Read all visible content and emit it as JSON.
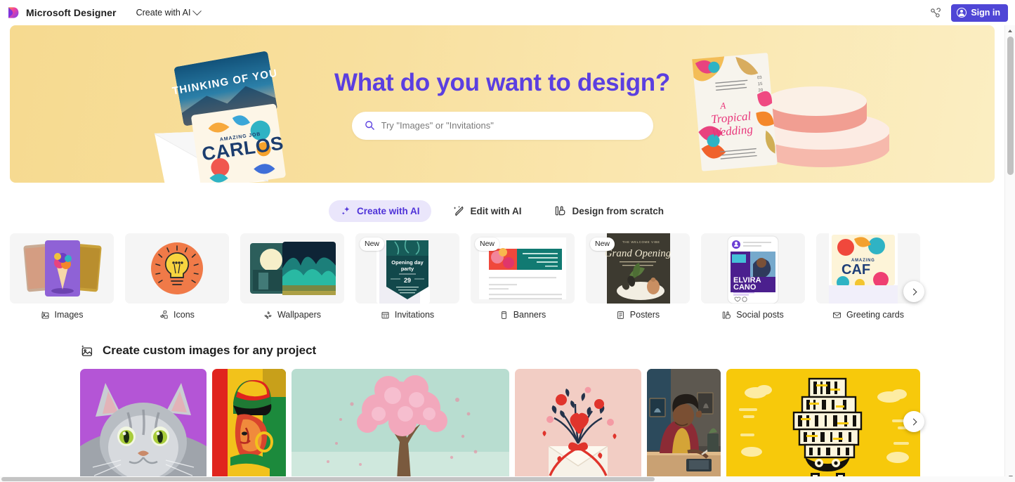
{
  "topbar": {
    "logo_icon": "designer-logo-icon",
    "brand": "Microsoft Designer",
    "nav": {
      "label": "Create with AI",
      "chevron_icon": "chevron-down-icon"
    },
    "share_icon": "link-share-icon",
    "signin": {
      "label": "Sign in",
      "icon": "person-circle-icon",
      "color": "#4f46d6"
    }
  },
  "hero": {
    "title": "What do you want to design?",
    "title_color": "#5b3fe0",
    "background_color": "#f8df9d",
    "search": {
      "placeholder": "Try \"Images\" or \"Invitations\"",
      "value": "",
      "icon": "search-icon"
    },
    "art_left": {
      "card_top_text": "THINKING OF YOU",
      "card_bottom_text": "CARLOS",
      "card_bottom_kicker": "AMAZING JOB"
    },
    "art_right": {
      "card_line1": "A",
      "card_line2": "Tropical",
      "card_line3": "Wedding",
      "card_date": "03 15 20"
    }
  },
  "modes": [
    {
      "label": "Create with AI",
      "icon": "sparkle-icon",
      "active": true
    },
    {
      "label": "Edit with AI",
      "icon": "magic-wand-icon",
      "active": false
    },
    {
      "label": "Design from scratch",
      "icon": "canvas-hand-icon",
      "active": false
    }
  ],
  "categories": [
    {
      "label": "Images",
      "icon": "image-sparkle-icon",
      "badge": "",
      "art": "images"
    },
    {
      "label": "Icons",
      "icon": "icons-icon",
      "badge": "",
      "art": "icons"
    },
    {
      "label": "Wallpapers",
      "icon": "wallpaper-icon",
      "badge": "",
      "art": "wallpapers"
    },
    {
      "label": "Invitations",
      "icon": "invitation-icon",
      "badge": "New",
      "art": "invitations"
    },
    {
      "label": "Banners",
      "icon": "banner-icon",
      "badge": "New",
      "art": "banners"
    },
    {
      "label": "Posters",
      "icon": "poster-icon",
      "badge": "New",
      "art": "posters"
    },
    {
      "label": "Social posts",
      "icon": "social-post-icon",
      "badge": "",
      "art": "social"
    },
    {
      "label": "Greeting cards",
      "icon": "envelope-icon",
      "badge": "",
      "art": "greeting"
    }
  ],
  "categories_next_label": "Next categories",
  "section": {
    "icon": "image-sparkle-icon",
    "title": "Create custom images for any project"
  },
  "gallery": [
    {
      "art": "cat",
      "alt": "Silver tabby cat on purple background"
    },
    {
      "art": "woman",
      "alt": "Woman with colorful headwrap illustration"
    },
    {
      "art": "tree",
      "alt": "Pink blossom tree on mint background"
    },
    {
      "art": "flowers",
      "alt": "Red hearts and flowers envelope illustration"
    },
    {
      "art": "artist",
      "alt": "Man drawing at a desk"
    },
    {
      "art": "books",
      "alt": "Stack of books robot on yellow background"
    }
  ],
  "gallery_next_label": "Next images",
  "scroll": {
    "vertical_thumb_label": "vertical-scrollbar",
    "horizontal_thumb_label": "horizontal-scrollbar"
  }
}
